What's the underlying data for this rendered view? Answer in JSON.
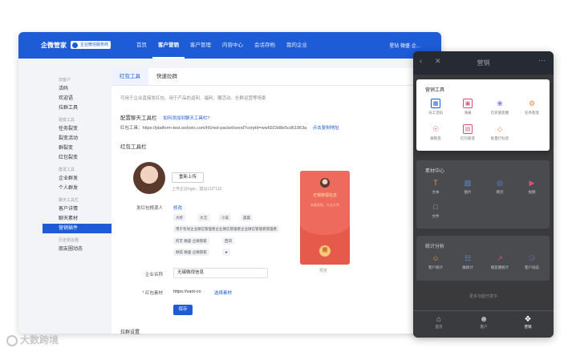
{
  "header": {
    "brand": "企微管家",
    "brand_badge": "企业微信服务商",
    "nav": [
      "首页",
      "客户营销",
      "客户管理",
      "内容中心",
      "会话存档",
      "我的企业"
    ],
    "active_nav": 1,
    "user": "星钻 微盛·企..."
  },
  "sidebar": {
    "groups": [
      {
        "title": "加客户",
        "items": [
          "活码",
          "欢迎语",
          "拉群工具"
        ]
      },
      {
        "title": "裂变工具",
        "items": [
          "任务裂变",
          "裂变活动",
          "群裂变",
          "红包裂变"
        ]
      },
      {
        "title": "群发工具",
        "items": [
          "企业群发",
          "个人群发"
        ]
      },
      {
        "title": "聊天工具栏",
        "items": [
          "客户详情",
          "聊天素材",
          "营销插件"
        ]
      },
      {
        "title": "历史朋友圈",
        "items": [
          "朋友圈动态"
        ]
      }
    ],
    "active_item": "营销插件"
  },
  "main": {
    "tabs": [
      "红包工具",
      "快速拉群"
    ],
    "active_tab": 0,
    "description": "可用于企业直接发红包、用于产品的返利、福利、赠活动、社群运营等场景",
    "config_title": "配置聊天工具栏",
    "config_help_link": "如何添加到聊天工具栏?",
    "url_label": "红包工具：",
    "url_value": "https://platform-test.wshoto.com/h5/red-packet/send?corpId=ww6923d8e5cd61963a",
    "copy_link": "点击复制地址",
    "toolbar_title": "红包工具栏",
    "upload_button": "重新上传",
    "upload_hint": "上传企业logo，建议112*112",
    "sender_label": "发红包根源人",
    "sender_edit": "修改",
    "sender_chips": [
      [
        "大虾",
        "大洁",
        "小美",
        "晨晨"
      ],
      [
        "用于有效企业微信管理者企业微信管理者企业微信管理者管理者"
      ],
      [
        "何丰 微盛·企微管家",
        "西郊"
      ],
      [
        "顾蓓 微盛·企微管家",
        "★"
      ]
    ],
    "company_label": "企业名称",
    "company_value": "无锡微视信息",
    "material_label": "红包素材",
    "material_value": "https://vant-co",
    "material_select": "选择素材",
    "save_button": "保存",
    "packet_name": "无锡微视信息",
    "packet_wish": "恭喜发财，大吉大利",
    "packet_coin": "開",
    "preview_label": "预览",
    "footer_partial": "拉群设置"
  },
  "phone": {
    "title": "营销",
    "marketing_title": "营销工具",
    "marketing_tools": [
      {
        "label": "员工活码",
        "icon": "qr-icon"
      },
      {
        "label": "海报",
        "icon": "poster-icon"
      },
      {
        "label": "历史朋友圈",
        "icon": "moments-icon"
      },
      {
        "label": "任务裂变",
        "icon": "task-icon"
      },
      {
        "label": "群裂变",
        "icon": "group-icon"
      },
      {
        "label": "红包裂变",
        "icon": "redpacket-icon"
      },
      {
        "label": "批量打标签",
        "icon": "tag-icon"
      }
    ],
    "material_title": "素材中心",
    "material_tools": [
      "文本",
      "图片",
      "网页",
      "视频",
      "文件"
    ],
    "stats_title": "统计分析",
    "stats_tools": [
      "客户统计",
      "群统计",
      "朋友圈统计",
      "客户动态"
    ],
    "empty_note": "更多功能开发中",
    "footer": [
      "首页",
      "客户",
      "营销"
    ],
    "colors": {
      "accent": "#1d5bd7",
      "packet": "#e65a4c"
    }
  },
  "watermark": "大数跨境"
}
